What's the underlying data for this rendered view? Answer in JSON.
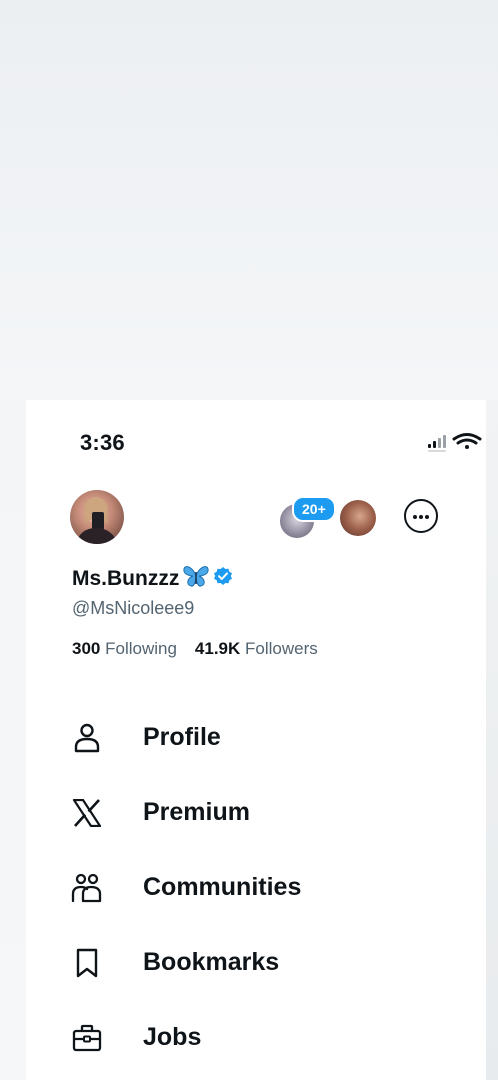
{
  "status_bar": {
    "time": "3:36",
    "icons": [
      "signal-icon",
      "wifi-icon"
    ]
  },
  "profile": {
    "display_name": "Ms.Bunzzz",
    "name_emoji": "butterfly-icon",
    "verified": true,
    "handle": "@MsNicoleee9",
    "following_count": "300",
    "following_label": "Following",
    "followers_count": "41.9K",
    "followers_label": "Followers"
  },
  "accounts": {
    "badge": "20+"
  },
  "menu": {
    "items": [
      {
        "label": "Profile",
        "icon": "person-icon"
      },
      {
        "label": "Premium",
        "icon": "x-logo-icon"
      },
      {
        "label": "Communities",
        "icon": "communities-icon"
      },
      {
        "label": "Bookmarks",
        "icon": "bookmark-icon"
      },
      {
        "label": "Jobs",
        "icon": "briefcase-icon"
      }
    ]
  },
  "colors": {
    "accent": "#1d9bf0",
    "text": "#0f1419",
    "secondary_text": "#536471",
    "background": "#ffffff"
  }
}
